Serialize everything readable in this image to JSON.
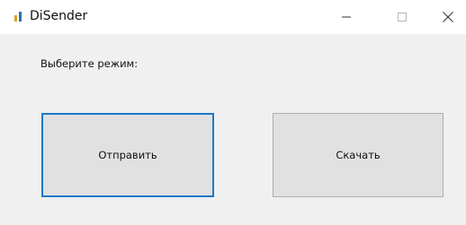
{
  "window": {
    "title": "DiSender",
    "icon": "app-bars-icon",
    "controls": {
      "minimize_icon": "minimize-icon",
      "maximize_icon": "maximize-icon",
      "close_icon": "close-icon"
    }
  },
  "main": {
    "prompt": "Выберите режим:",
    "send_label": "Отправить",
    "download_label": "Скачать"
  },
  "colors": {
    "focus_border": "#1e78c8",
    "button_bg": "#e1e1e1",
    "window_bg": "#f0f0f0"
  }
}
